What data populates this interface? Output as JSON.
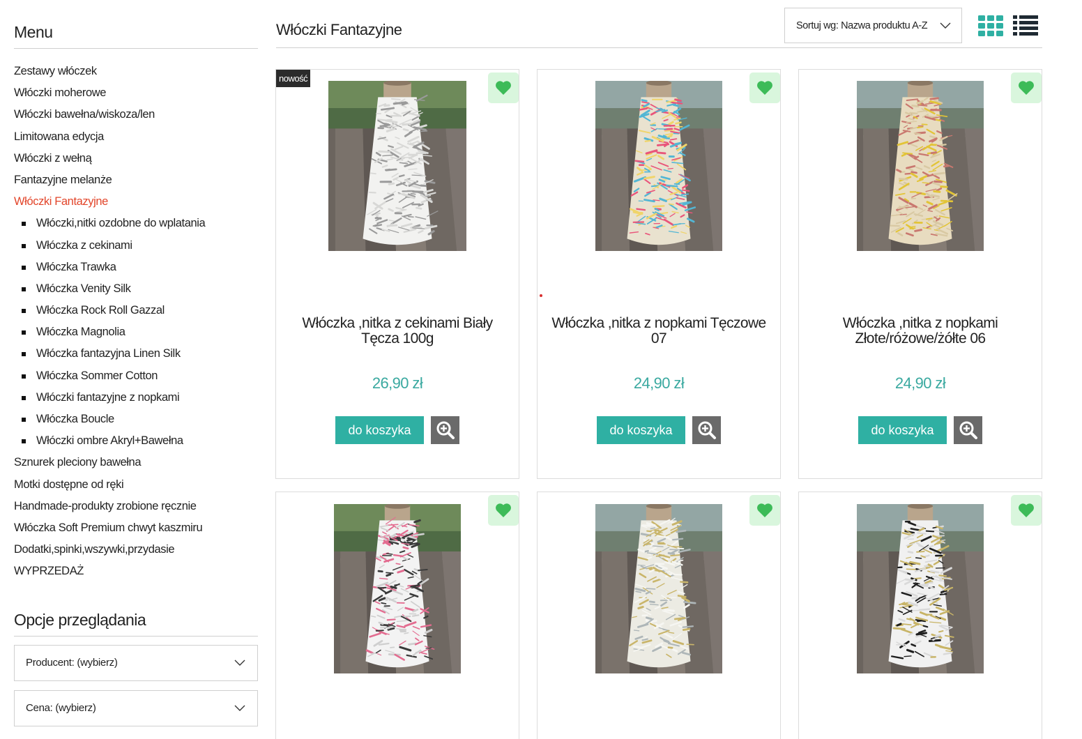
{
  "sidebar": {
    "menu_title": "Menu",
    "items": [
      {
        "label": "Zestawy włóczek",
        "level": 0
      },
      {
        "label": "Włóczki moherowe",
        "level": 0
      },
      {
        "label": "Włóczki bawełna/wiskoza/len",
        "level": 0
      },
      {
        "label": "Limitowana edycja",
        "level": 0
      },
      {
        "label": "Włóczki z wełną",
        "level": 0
      },
      {
        "label": "Fantazyjne melanże",
        "level": 0
      },
      {
        "label": "Włóczki Fantazyjne",
        "level": 0,
        "active": true
      },
      {
        "label": "Włóczki,nitki ozdobne do wplatania",
        "level": 1
      },
      {
        "label": "Włóczka z cekinami",
        "level": 1
      },
      {
        "label": "Włóczka Trawka",
        "level": 1
      },
      {
        "label": "Włóczka Venity Silk",
        "level": 1
      },
      {
        "label": "Włóczka Rock Roll Gazzal",
        "level": 1
      },
      {
        "label": "Włóczka Magnolia",
        "level": 1
      },
      {
        "label": "Włóczka fantazyjna Linen Silk",
        "level": 1
      },
      {
        "label": "Włóczka Sommer Cotton",
        "level": 1
      },
      {
        "label": "Włóczki fantazyjne z nopkami",
        "level": 1
      },
      {
        "label": "Włóczka Boucle",
        "level": 1
      },
      {
        "label": "Włóczki ombre Akryl+Bawełna",
        "level": 1
      },
      {
        "label": "Sznurek pleciony bawełna",
        "level": 0
      },
      {
        "label": "Motki dostępne od ręki",
        "level": 0
      },
      {
        "label": "Handmade-produkty zrobione ręcznie",
        "level": 0
      },
      {
        "label": "Włóczka Soft Premium chwyt kaszmiru",
        "level": 0
      },
      {
        "label": "Dodatki,spinki,wszywki,przydasie",
        "level": 0
      },
      {
        "label": "WYPRZEDAŻ",
        "level": 0
      }
    ],
    "options_title": "Opcje przeglądania",
    "producer_filter": "Producent: (wybierz)",
    "price_filter": "Cena: (wybierz)"
  },
  "header": {
    "page_title": "Włóczki Fantazyjne",
    "sort_label": "Sortuj wg: Nazwa produktu A-Z"
  },
  "products": [
    {
      "name": "Włóczka ,nitka z cekinami Biały Tęcza 100g",
      "price": "26,90 zł",
      "badge": "nowość",
      "cart_label": "do koszyka",
      "yarn_colors": [
        "#f2f2f0",
        "#d8d8d6",
        "#9a9a9a"
      ]
    },
    {
      "name": "Włóczka ,nitka z nopkami Tęczowe 07",
      "price": "24,90 zł",
      "badge": "",
      "cart_label": "do koszyka",
      "yarn_colors": [
        "#e9e2cf",
        "#e9557a",
        "#53b6d4",
        "#f0d46a"
      ]
    },
    {
      "name": "Włóczka ,nitka z nopkami Złote/różowe/żółte 06",
      "price": "24,90 zł",
      "badge": "",
      "cart_label": "do koszyka",
      "yarn_colors": [
        "#e8dcc0",
        "#e2c436",
        "#c9786f",
        "#d9c9a3"
      ]
    },
    {
      "name": "",
      "price": "",
      "badge": "",
      "cart_label": "",
      "yarn_colors": [
        "#f3f3f3",
        "#e36c90",
        "#3a3a3a",
        "#cfcfcf"
      ]
    },
    {
      "name": "",
      "price": "",
      "badge": "",
      "cart_label": "",
      "yarn_colors": [
        "#ecebe3",
        "#c9b56a",
        "#aeb6b8",
        "#f6f6f2"
      ]
    },
    {
      "name": "",
      "price": "",
      "badge": "",
      "cart_label": "",
      "yarn_colors": [
        "#f1f1f1",
        "#1e1e1e",
        "#c8b466",
        "#d9d9d9"
      ]
    }
  ],
  "colors": {
    "accent": "#2fb0a3",
    "price": "#3aa9a0",
    "active_menu": "#e2452a",
    "favorite_bg": "#d9f6dd",
    "favorite_icon": "#3dbb58"
  },
  "icons": {
    "grid_view": "grid-view-icon",
    "list_view": "list-view-icon",
    "favorite": "heart-icon",
    "zoom": "zoom-in-icon",
    "dropdown": "chevron-down-icon"
  }
}
